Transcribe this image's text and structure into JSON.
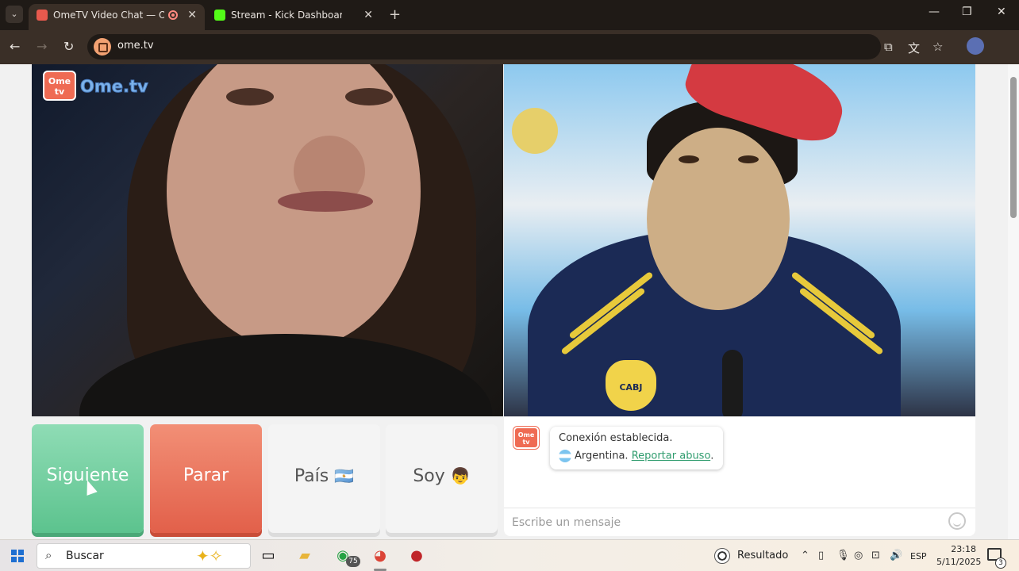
{
  "browser": {
    "tabs": [
      {
        "title": "OmeTV Video Chat — Ome",
        "active": true,
        "favicon_color": "#e8594d"
      },
      {
        "title": "Stream - Kick Dashboard",
        "active": false,
        "favicon_color": "#53fc18"
      }
    ],
    "url": "ome.tv"
  },
  "page": {
    "logo_badge": "Ome\ntv",
    "logo_text": "Ome.tv",
    "buttons": {
      "next": "Siguiente",
      "stop": "Parar",
      "country": "País",
      "me": "Soy"
    },
    "chat": {
      "connection_message": "Conexión establecida.",
      "country": "Argentina.",
      "report_link": "Reportar abuso",
      "report_suffix": ".",
      "input_placeholder": "Escribe un mensaje"
    },
    "colors": {
      "next_button": "#6fcf9c",
      "stop_button": "#e9735c",
      "logo": "#ef6b53",
      "link": "#2f9c6e"
    }
  },
  "taskbar": {
    "search_label": "Buscar",
    "whatsapp_badge": "75",
    "weather_label": "Resultado",
    "language": "ESP",
    "time": "23:18",
    "date": "5/11/2025",
    "notifications_count": "3"
  }
}
